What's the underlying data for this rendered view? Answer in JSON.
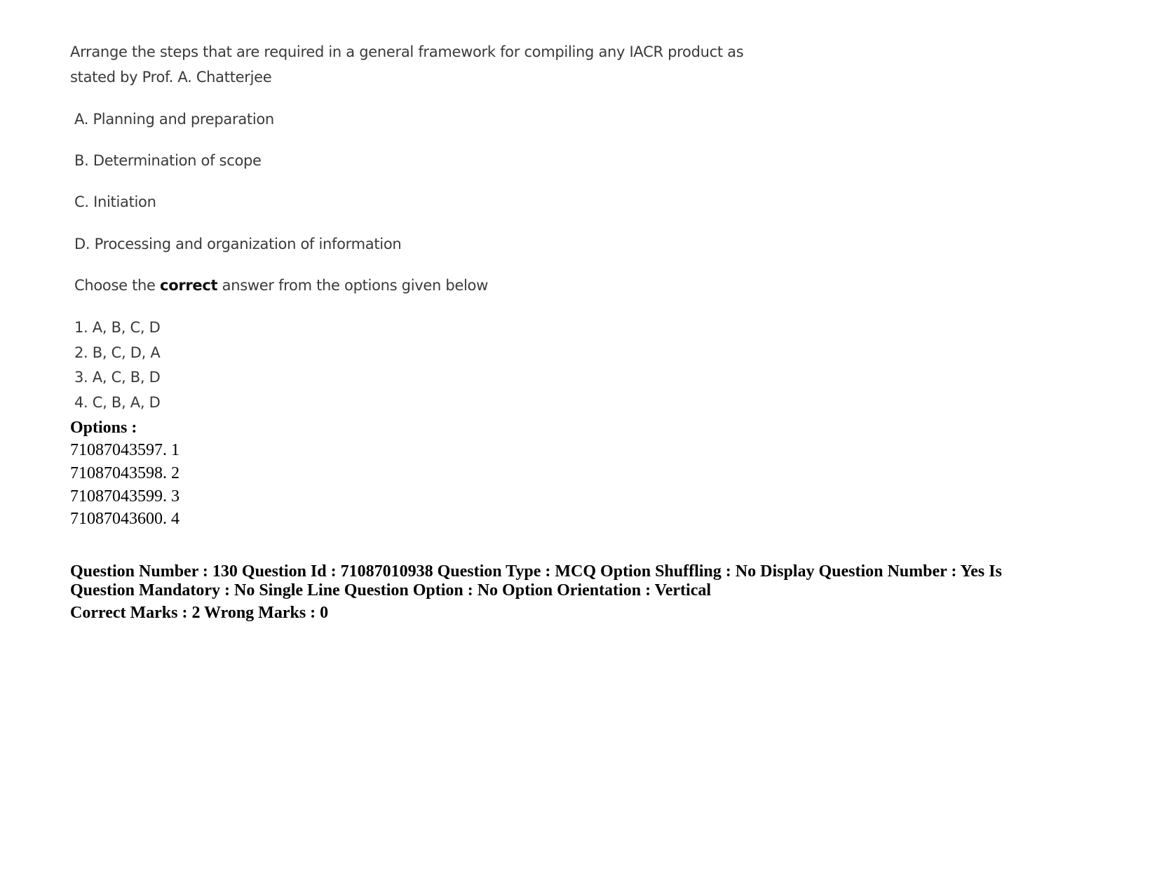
{
  "question": {
    "stem_line1": "Arrange the steps that are required in a general framework for compiling any IACR product as",
    "stem_line2": "stated by Prof. A. Chatterjee",
    "items": [
      "A. Planning and preparation",
      "B. Determination of scope",
      "C. Initiation",
      "D. Processing and organization of information"
    ],
    "instruction_pre": "Choose the ",
    "instruction_bold": "correct",
    "instruction_post": " answer from the options given below",
    "choices": [
      "1. A, B, C, D",
      "2. B, C, D, A",
      "3. A, C, B, D",
      "4. C, B, A, D"
    ]
  },
  "options": {
    "heading": "Options :",
    "list": [
      "71087043597. 1",
      "71087043598. 2",
      "71087043599. 3",
      "71087043600. 4"
    ]
  },
  "next_meta": {
    "line1": "Question Number : 130 Question Id : 71087010938 Question Type : MCQ Option Shuffling : No Display Question Number : Yes Is",
    "line2": "Question Mandatory : No Single Line Question Option : No Option Orientation : Vertical",
    "marks": "Correct Marks : 2 Wrong Marks : 0"
  }
}
